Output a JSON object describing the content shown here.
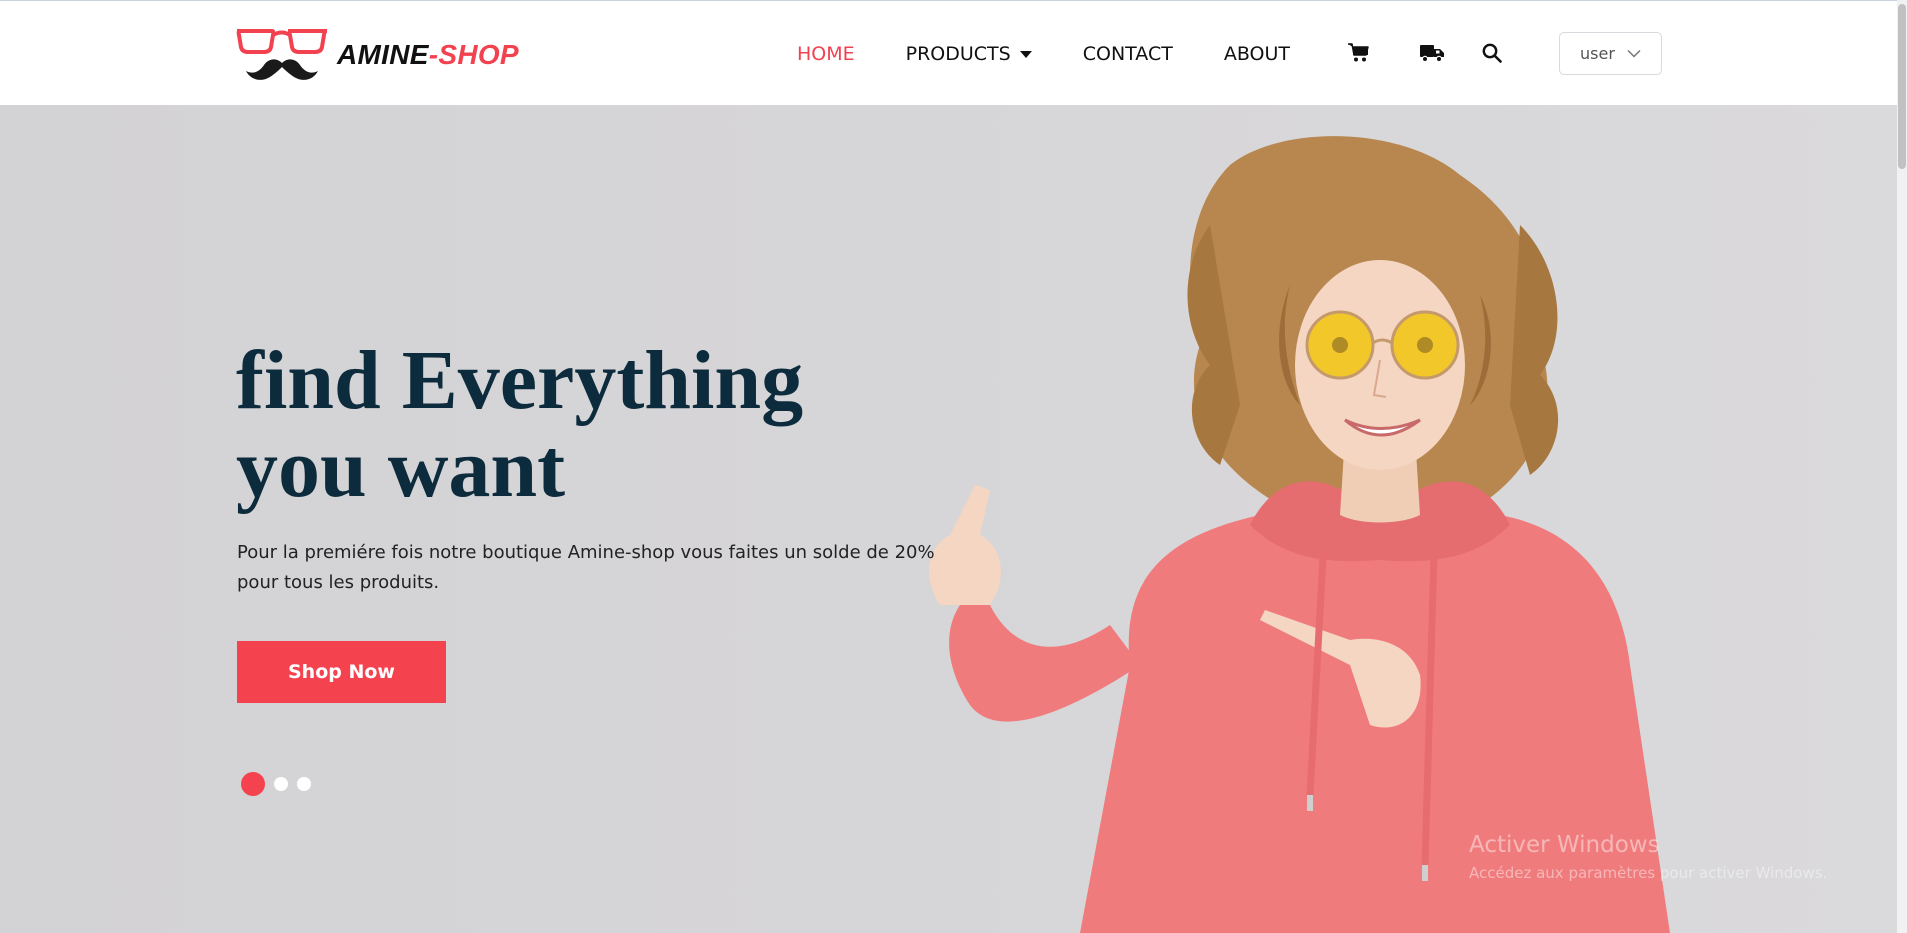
{
  "brand": {
    "name_part1": "AMINE",
    "name_part2": "-SHOP",
    "logo_icon": "glasses-mustache-icon",
    "accent_color": "#f2414f"
  },
  "nav": {
    "items": [
      {
        "label": "HOME",
        "active": true
      },
      {
        "label": "PRODUCTS",
        "has_dropdown": true
      },
      {
        "label": "CONTACT"
      },
      {
        "label": "ABOUT"
      }
    ],
    "icons": [
      "cart-icon",
      "delivery-truck-icon",
      "search-icon"
    ],
    "user_select": {
      "value": "user",
      "icon": "chevron-down-icon"
    }
  },
  "hero": {
    "headline_line1": "find Everything",
    "headline_line2": "you want",
    "subtext": "Pour la premiére fois notre boutique Amine-shop vous faites un solde de 20% pour tous les produits.",
    "cta_label": "Shop Now",
    "slides": {
      "count": 3,
      "active": 1
    },
    "heading_color": "#0c2b3d",
    "cta_color": "#f5424f"
  },
  "watermark": {
    "line1": "Activer Windows",
    "line2": "Accédez aux paramètres pour activer Windows."
  }
}
